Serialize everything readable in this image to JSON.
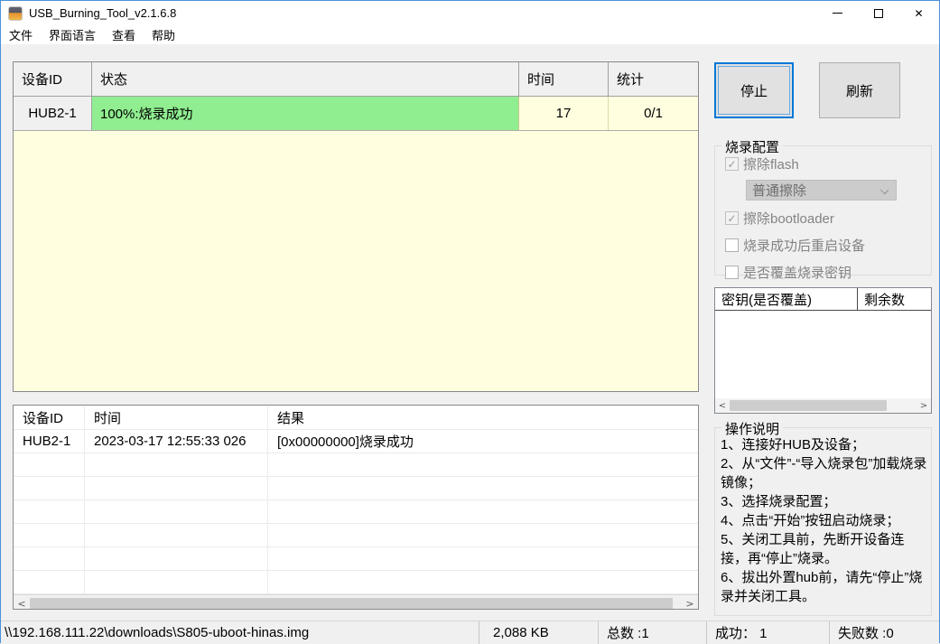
{
  "window": {
    "title": "USB_Burning_Tool_v2.1.6.8"
  },
  "menu": {
    "file": "文件",
    "language": "界面语言",
    "view": "查看",
    "help": "帮助"
  },
  "device_table": {
    "headers": {
      "device_id": "设备ID",
      "status": "状态",
      "time": "时间",
      "stats": "统计"
    },
    "row": {
      "device_id": "HUB2-1",
      "status": "100%:烧录成功",
      "time": "17",
      "stats": "0/1"
    }
  },
  "actions": {
    "stop": "停止",
    "refresh": "刷新"
  },
  "burn_config": {
    "title": "烧录配置",
    "erase_flash_label": "擦除flash",
    "erase_flash_checked": true,
    "erase_mode_value": "普通擦除",
    "erase_bootloader_label": "擦除bootloader",
    "erase_bootloader_checked": true,
    "reboot_label": "烧录成功后重启设备",
    "reboot_checked": false,
    "overwrite_key_label": "是否覆盖烧录密钥",
    "overwrite_key_checked": false
  },
  "key_table": {
    "header_key": "密钥(是否覆盖)",
    "header_remaining": "剩余数",
    "rows": []
  },
  "instructions": {
    "title": "操作说明",
    "text": "1、连接好HUB及设备；\n2、从“文件”-“导入烧录包”加载烧录镜像；\n3、选择烧录配置；\n4、点击“开始”按钮启动烧录；\n5、关闭工具前，先断开设备连接，再“停止”烧录。\n6、拔出外置hub前，请先“停止”烧录并关闭工具。"
  },
  "log_table": {
    "headers": {
      "device_id": "设备ID",
      "time": "时间",
      "result": "结果"
    },
    "row": {
      "device_id": "HUB2-1",
      "time": "2023-03-17 12:55:33 026",
      "result": "[0x00000000]烧录成功"
    }
  },
  "status_bar": {
    "path": "\\\\192.168.111.22\\downloads\\S805-uboot-hinas.img",
    "size": "2,088 KB",
    "total": "总数 :1",
    "success": "成功： 1",
    "failed": "失败数 :0"
  },
  "icons": {
    "check": "✓",
    "close": "✕",
    "scroll_left": "<",
    "scroll_right": ">"
  },
  "colors": {
    "accent_blue": "#0078D7",
    "success_green": "#90EE90",
    "pending_yellow": "#FFFFE0",
    "disabled_gray": "#CCCCCC"
  }
}
